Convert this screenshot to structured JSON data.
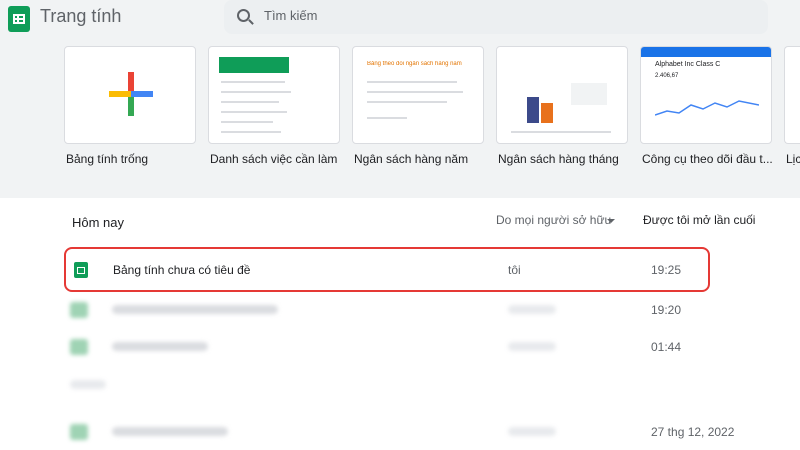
{
  "app": {
    "title": "Trang tính"
  },
  "search": {
    "placeholder": "Tìm kiếm"
  },
  "templates": [
    {
      "label": "Bảng tính trống"
    },
    {
      "label": "Danh sách việc cần làm"
    },
    {
      "label": "Ngân sách hàng năm"
    },
    {
      "label": "Ngân sách hàng tháng"
    },
    {
      "label": "Công cụ theo dõi đầu t..."
    },
    {
      "label": "Lịc"
    }
  ],
  "thumbs": {
    "annual_title": "Bảng theo dõi ngân sách hàng năm",
    "stock_name": "Alphabet Inc Class C",
    "stock_price": "2.406,67"
  },
  "list": {
    "section_title": "Hôm nay",
    "owner_filter": "Do mọi người sở hữu",
    "sort_header": "Được tôi mở lần cuối",
    "rows": [
      {
        "name": "Bảng tính chưa có tiêu đề",
        "owner": "tôi",
        "time": "19:25"
      },
      {
        "time": "19:20"
      },
      {
        "time": "01:44"
      },
      {
        "time": "27 thg 12, 2022"
      }
    ]
  },
  "colors": {
    "sheets_green": "#0f9d58",
    "highlight_red": "#e53935",
    "header_bg": "#f1f3f4"
  }
}
